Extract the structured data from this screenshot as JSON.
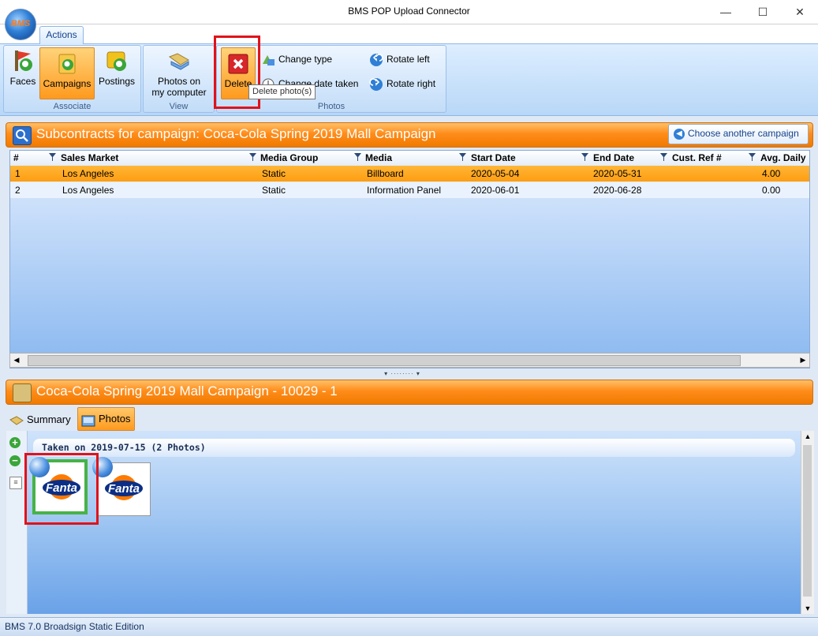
{
  "window": {
    "title": "BMS POP Upload Connector",
    "logo_text": "BMS",
    "minimize": "—",
    "maximize": "☐",
    "close": "✕"
  },
  "ribbon": {
    "tab": "Actions",
    "groups": {
      "associate": {
        "label": "Associate",
        "buttons": [
          "Faces",
          "Campaigns",
          "Postings"
        ]
      },
      "view": {
        "label": "View",
        "button_line1": "Photos on",
        "button_line2": "my computer"
      },
      "photos": {
        "label": "Photos",
        "delete": "Delete",
        "change_type": "Change type",
        "change_date": "Change date taken",
        "rotate_left": "Rotate left",
        "rotate_right": "Rotate right",
        "tooltip": "Delete photo(s)"
      }
    }
  },
  "subcontracts": {
    "title": "Subcontracts for campaign: Coca-Cola Spring 2019 Mall Campaign",
    "choose_button": "Choose another campaign",
    "columns": [
      "#",
      "Sales Market",
      "Media Group",
      "Media",
      "Start Date",
      "End Date",
      "Cust. Ref #",
      "Avg. Daily"
    ],
    "rows": [
      [
        "1",
        "Los Angeles",
        "Static",
        "Billboard",
        "2020-05-04",
        "2020-05-31",
        "",
        "4.00"
      ],
      [
        "2",
        "Los Angeles",
        "Static",
        "Information Panel",
        "2020-06-01",
        "2020-06-28",
        "",
        "0.00"
      ]
    ]
  },
  "campaign_panel": {
    "title": "Coca-Cola Spring 2019 Mall Campaign  - 10029 - 1",
    "tabs": [
      "Summary",
      "Photos"
    ],
    "group_header": "Taken on 2019-07-15  (2 Photos)",
    "photos": [
      {
        "logo_text": "Fanta",
        "selected": true
      },
      {
        "logo_text": "Fanta",
        "selected": false
      }
    ]
  },
  "status": {
    "text": "BMS 7.0 Broadsign Static Edition"
  },
  "colors": {
    "accent_orange": "#ff8c1a",
    "selection_row": "#ffa31a",
    "highlight_red": "#e0121b"
  }
}
